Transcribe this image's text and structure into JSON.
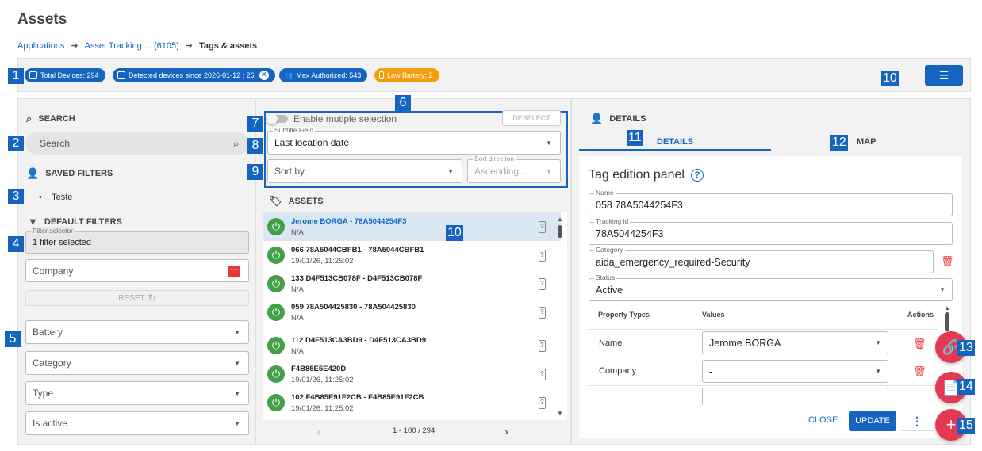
{
  "page": {
    "title": "Assets"
  },
  "breadcrumb": {
    "item1": "Applications",
    "item2": "Asset Tracking ... (6105)",
    "current": "Tags & assets"
  },
  "chips": {
    "total": "Total Devices: 294",
    "detected": "Detected devices since 2026-01-12 : 26",
    "max": "Max Authorized: 543",
    "low": "Low Battery: 2"
  },
  "colors": {
    "primary": "#1565c0",
    "warning": "#f59e0b",
    "danger": "#e53935",
    "fab": "#e53951",
    "success": "#43a047"
  },
  "badges": {
    "b1": "1",
    "b2": "2",
    "b3": "3",
    "b4": "4",
    "b5": "5",
    "b6": "6",
    "b7": "7",
    "b8": "8",
    "b9": "9",
    "b10a": "10",
    "b10b": "10",
    "b11": "11",
    "b12": "12",
    "b13": "13",
    "b14": "14",
    "b15": "15"
  },
  "left": {
    "search_title": "SEARCH",
    "search_placeholder": "Search",
    "saved_title": "SAVED FILTERS",
    "saved_item": "Teste",
    "default_title": "DEFAULT FILTERS",
    "filter_selector_label": "Filter selector",
    "filter_selector_value": "1 filter selected",
    "company": "Company",
    "reset": "RESET",
    "battery": "Battery",
    "category": "Category",
    "type": "Type",
    "is_active": "Is active"
  },
  "middle": {
    "enable_multi": "Enable mutiple selection",
    "deselect": "DESELECT",
    "subtitle_label": "Subtitle Field",
    "subtitle_value": "Last location date",
    "sort_by": "Sort by",
    "sort_dir_label": "Sort direction",
    "sort_dir_value": "Ascending ...",
    "assets_title": "ASSETS",
    "pagination": "1 - 100 / 294",
    "rows": [
      {
        "title": "Jerome BORGA - 78A5044254F3",
        "sub": "N/A"
      },
      {
        "title": "066 78A5044CBFB1 - 78A5044CBFB1",
        "sub": "19/01/26, 11:25:02"
      },
      {
        "title": "133 D4F513CB078F - D4F513CB078F",
        "sub": "N/A"
      },
      {
        "title": "059 78A504425830 - 78A504425830",
        "sub": "N/A"
      },
      {
        "title": "112 D4F513CA3BD9 - D4F513CA3BD9",
        "sub": "N/A"
      },
      {
        "title": "F4B85E5E420D",
        "sub": "19/01/26, 11:25:02"
      },
      {
        "title": "102 F4B85E91F2CB - F4B85E91F2CB",
        "sub": "19/01/26, 11:25:02"
      }
    ]
  },
  "right": {
    "details_title": "DETAILS",
    "tab_details": "DETAILS",
    "tab_map": "MAP",
    "panel_title": "Tag edition panel",
    "name_label": "Name",
    "name_value": "058 78A5044254F3",
    "tracking_label": "Tracking id",
    "tracking_value": "78A5044254F3",
    "category_label": "Category",
    "category_value": "aida_emergency_required-Security",
    "status_label": "Status",
    "status_value": "Active",
    "col_types": "Property Types",
    "col_values": "Values",
    "col_actions": "Actions",
    "prop1_type": "Name",
    "prop1_value": "Jerome BORGA",
    "prop2_type": "Company",
    "prop2_value": "-",
    "close": "CLOSE",
    "update": "UPDATE"
  }
}
